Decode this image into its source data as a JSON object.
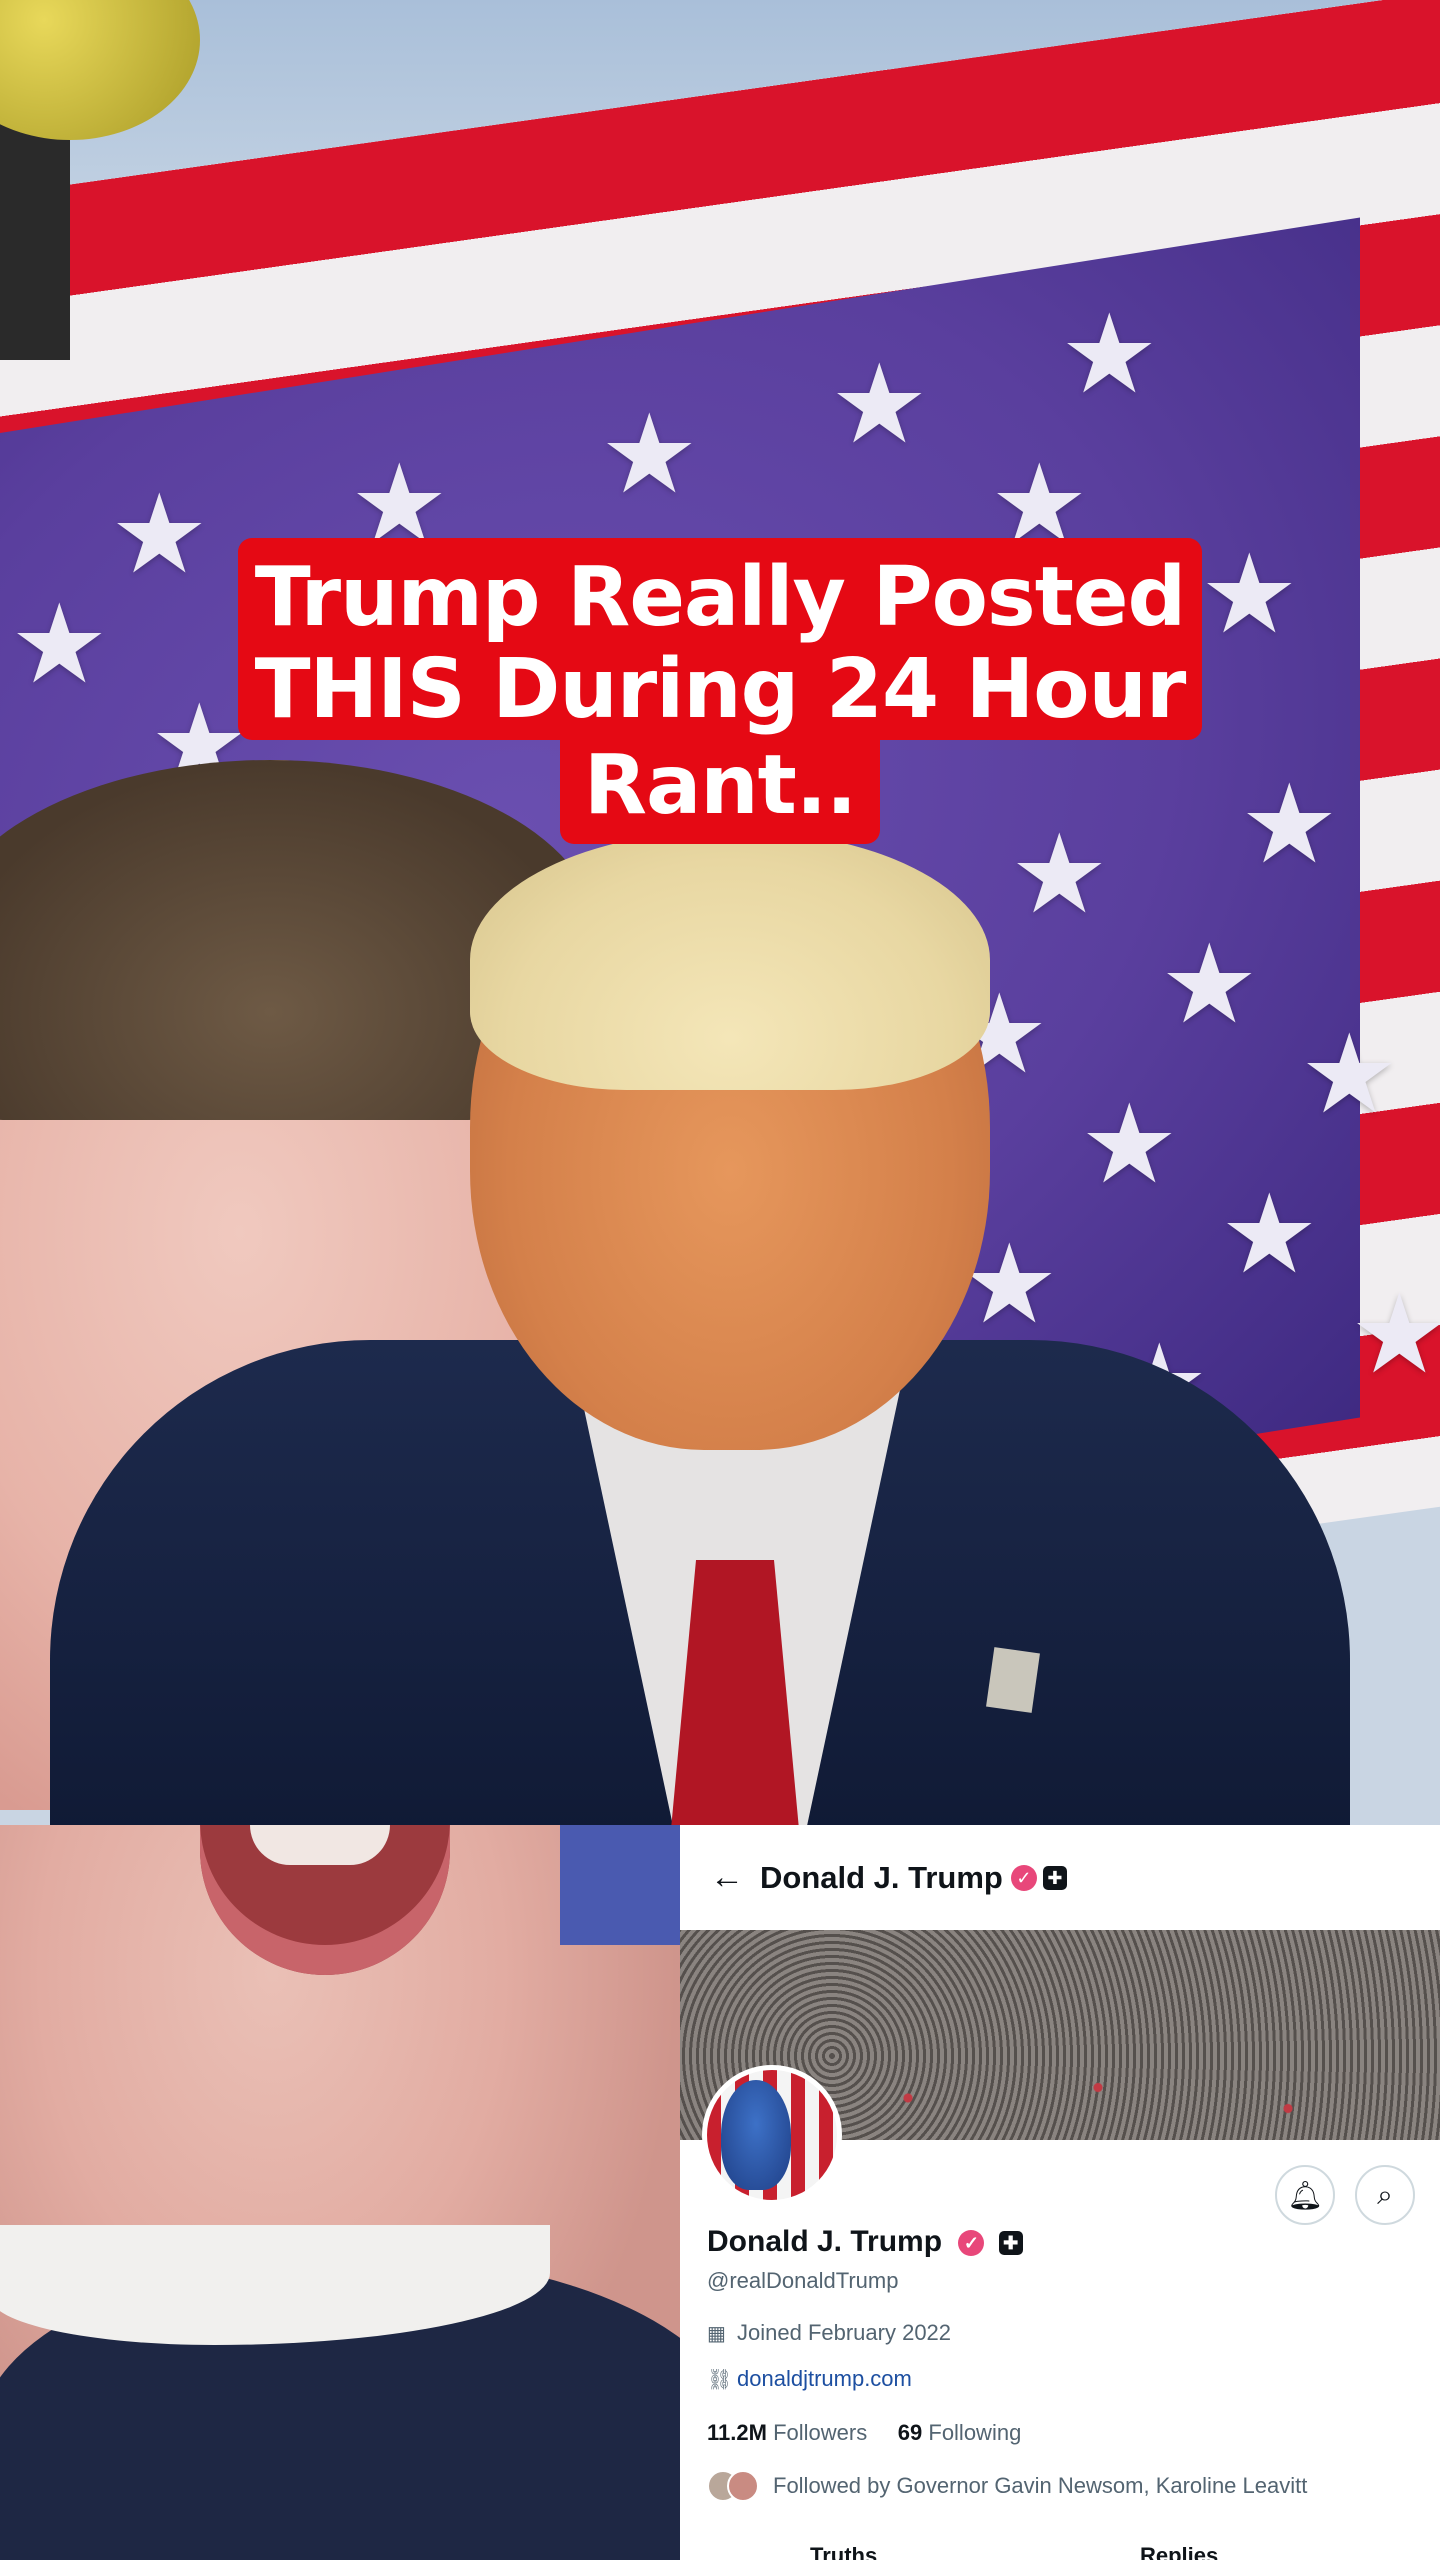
{
  "headline": {
    "line1": "Trump Really Posted",
    "line2": "THIS During 24 Hour",
    "line3": "Rant.."
  },
  "profile": {
    "topbar_name": "Donald J. Trump",
    "name": "Donald J. Trump",
    "handle": "@realDonaldTrump",
    "joined": "Joined February 2022",
    "website": "donaldjtrump.com",
    "followers_count": "11.2M",
    "followers_label": "Followers",
    "following_count": "69",
    "following_label": "Following",
    "followed_by": "Followed by Governor Gavin Newsom, Karoline Leavitt",
    "tabs": [
      "Truths",
      "Replies"
    ]
  },
  "icons": {
    "back": "arrow-left-icon",
    "verified": "verified-badge-icon",
    "affiliation": "affiliation-badge-icon",
    "notify": "bell-icon",
    "search": "search-icon",
    "calendar": "calendar-icon",
    "link": "link-icon"
  },
  "colors": {
    "headline_bg": "#e50914",
    "verified": "#e8477a",
    "link": "#1d4fa1"
  }
}
